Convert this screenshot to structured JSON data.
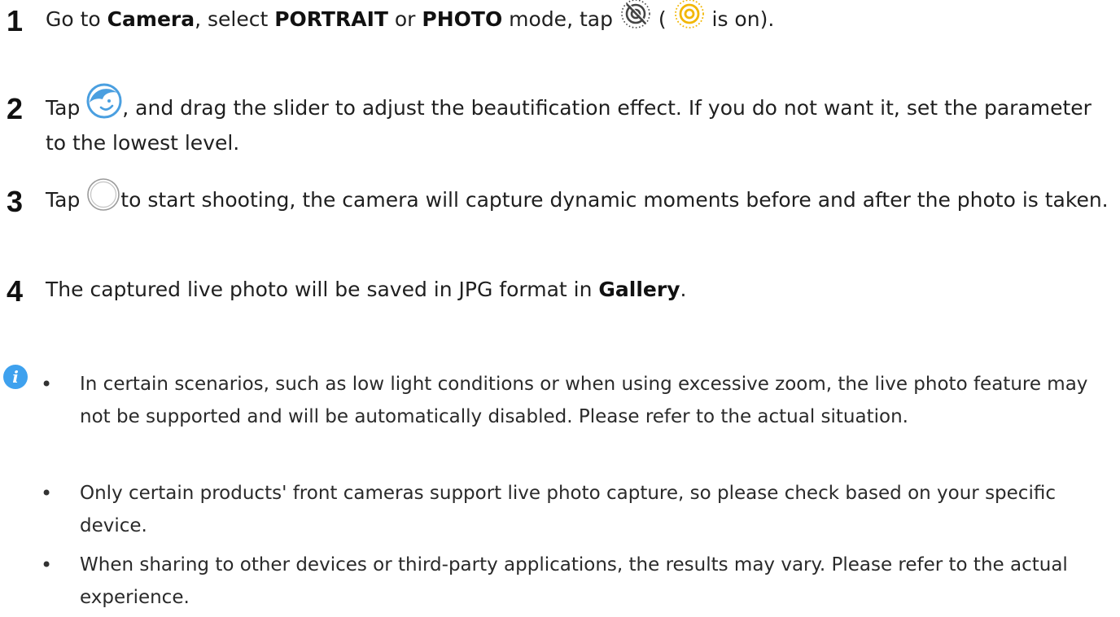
{
  "steps": [
    {
      "number": "1",
      "t1": "Go to ",
      "b1": "Camera",
      "t2": ", select ",
      "b2": "PORTRAIT",
      "t3": " or ",
      "b3": "PHOTO",
      "t4": " mode, tap ",
      "t5": " ( ",
      "t6": " is on).",
      "icons": [
        "live-photo-off-icon",
        "live-photo-on-icon"
      ]
    },
    {
      "number": "2",
      "t1": "Tap ",
      "t2": ", and drag the slider to adjust the beautification effect. If you do not want it, set the parameter to the lowest level.",
      "icons": [
        "beauty-face-icon"
      ]
    },
    {
      "number": "3",
      "t1": "Tap ",
      "t2": "to start shooting, the camera will capture dynamic moments before and after the photo is taken.",
      "icons": [
        "shutter-icon"
      ]
    },
    {
      "number": "4",
      "t1": "The captured live photo will be saved in JPG format in ",
      "b1": "Gallery",
      "t2": "."
    }
  ],
  "notes": {
    "icon": "info-icon",
    "icon_glyph": "i",
    "bullet": "•",
    "items": [
      "In certain scenarios, such as low light conditions or when using excessive zoom, the live photo feature may not be supported and will be automatically disabled. Please refer to the actual situation.",
      "Only certain products' front cameras support live photo capture, so please check based on your specific device.",
      "When sharing to other devices or third-party applications, the results may vary. Please refer to the actual experience."
    ]
  },
  "colors": {
    "live_on": "#f2b705",
    "info_blue": "#3ea1ee",
    "beauty_blue": "#4a9fe0"
  }
}
